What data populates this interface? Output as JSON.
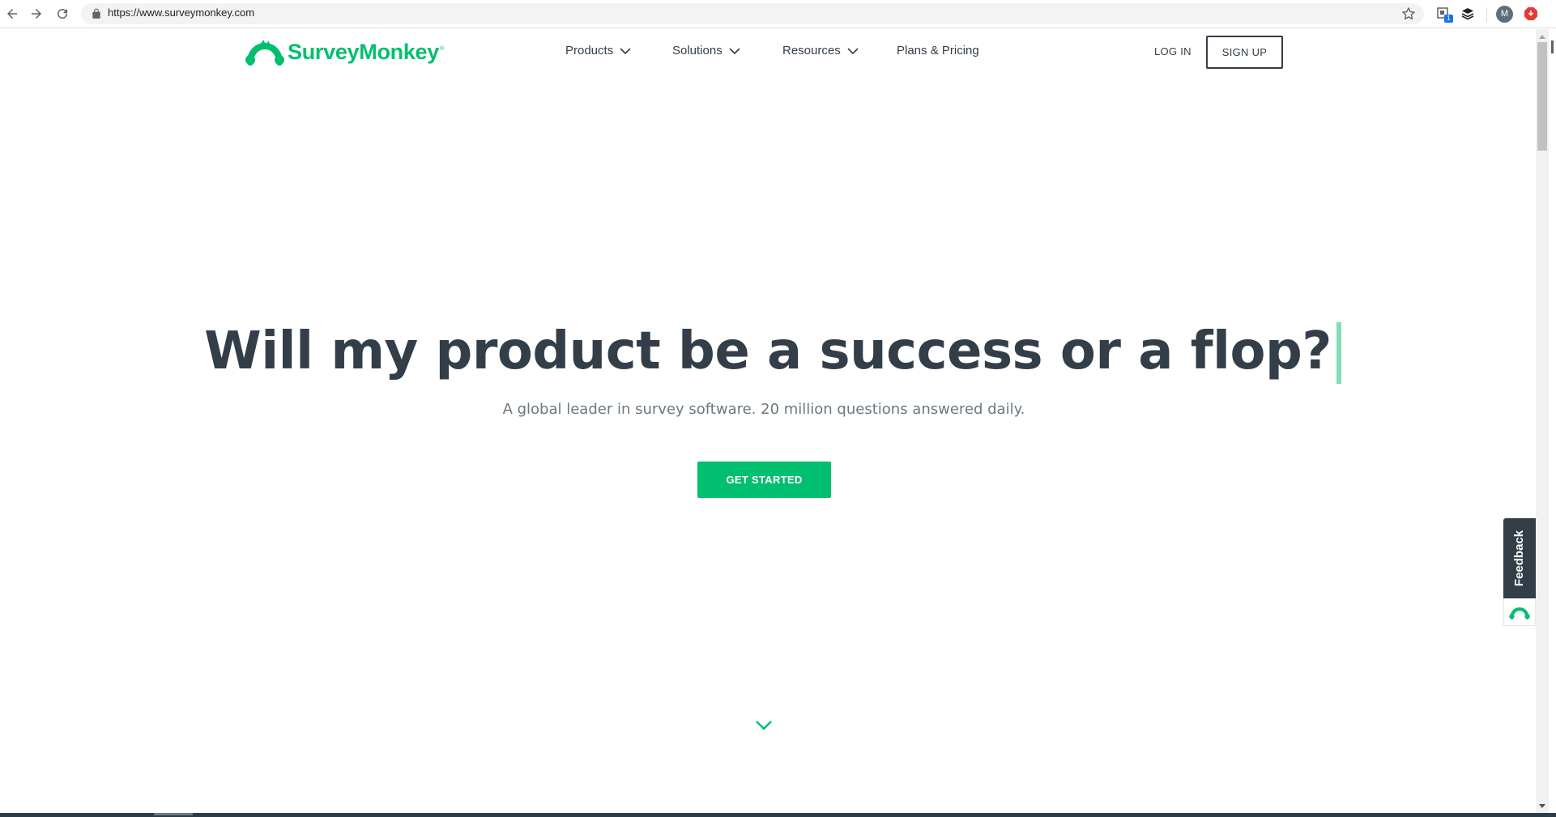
{
  "browser": {
    "url": "https://www.surveymonkey.com",
    "profile_initial": "M",
    "extension_badge": "1"
  },
  "header": {
    "logo_text": "SurveyMonkey",
    "logo_mark": "®",
    "nav": [
      {
        "label": "Products",
        "has_dropdown": true
      },
      {
        "label": "Solutions",
        "has_dropdown": true
      },
      {
        "label": "Resources",
        "has_dropdown": true
      },
      {
        "label": "Plans & Pricing",
        "has_dropdown": false
      }
    ],
    "login_label": "LOG IN",
    "signup_label": "SIGN UP"
  },
  "hero": {
    "title": "Will my product be a success or a flop?",
    "subtitle": "A global leader in survey software. 20 million questions answered daily.",
    "cta_label": "GET STARTED"
  },
  "feedback": {
    "label": "Feedback"
  },
  "colors": {
    "brand_green": "#00bf6f",
    "text_dark": "#333e48",
    "text_muted": "#6b787f",
    "cursor_green": "#7fdfb7"
  },
  "icons": {
    "back": "arrow-left-icon",
    "forward": "arrow-right-icon",
    "reload": "reload-icon",
    "lock": "lock-icon",
    "bookmark": "star-icon",
    "scroll_down": "chevron-down-icon"
  }
}
